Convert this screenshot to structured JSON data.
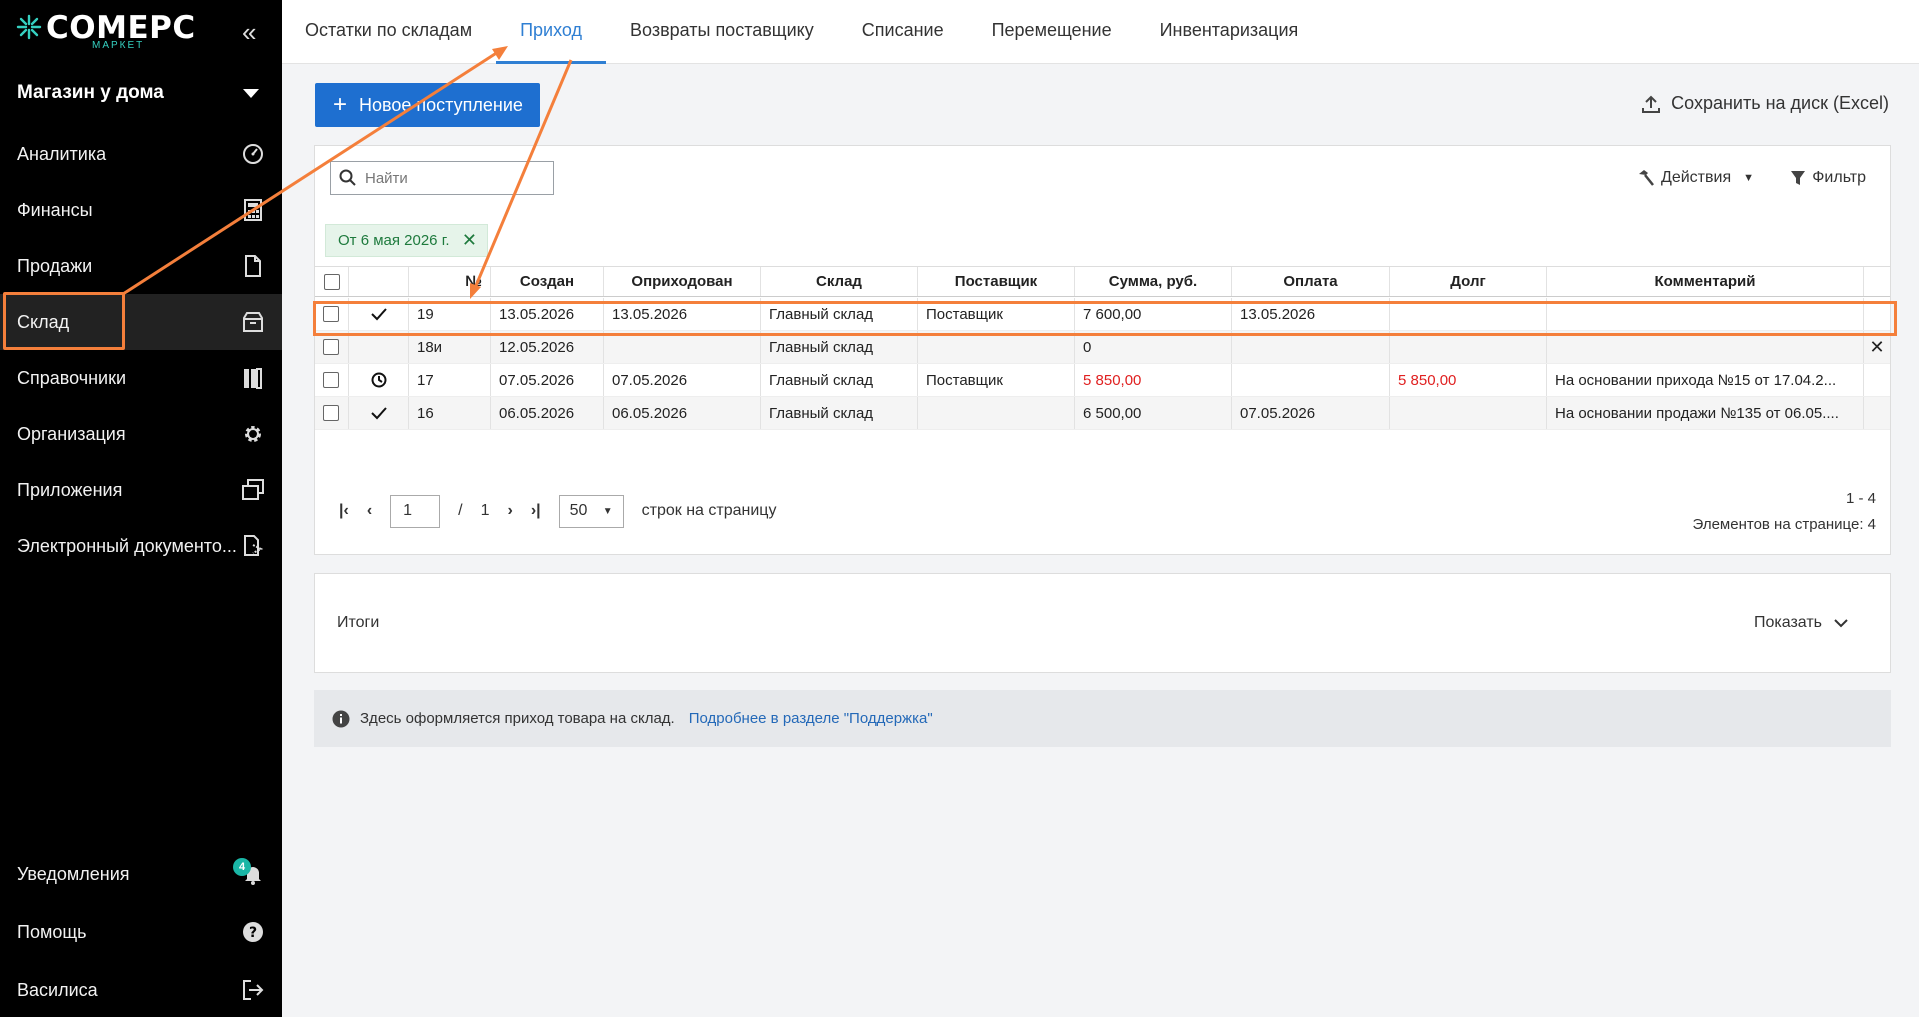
{
  "app": {
    "logo_text": "COMEPC",
    "logo_sub": "МАРКЕТ",
    "store": "Магазин у дома",
    "accent": "#1e6fd0",
    "highlight": "#f47f3b"
  },
  "sidebar": {
    "items": [
      {
        "label": "Аналитика",
        "icon": "speedometer-icon"
      },
      {
        "label": "Финансы",
        "icon": "calculator-icon"
      },
      {
        "label": "Продажи",
        "icon": "document-icon"
      },
      {
        "label": "Склад",
        "icon": "box-icon",
        "active": true
      },
      {
        "label": "Справочники",
        "icon": "books-icon"
      },
      {
        "label": "Организация",
        "icon": "gear-icon"
      },
      {
        "label": "Приложения",
        "icon": "windows-icon"
      },
      {
        "label": "Электронный документо...",
        "icon": "edoc-icon"
      }
    ],
    "bottom": [
      {
        "label": "Уведомления",
        "icon": "bell-icon",
        "badge": "4"
      },
      {
        "label": "Помощь",
        "icon": "help-icon"
      },
      {
        "label": "Василиса",
        "icon": "logout-icon"
      }
    ]
  },
  "tabs": [
    {
      "label": "Остатки по складам"
    },
    {
      "label": "Приход",
      "active": true
    },
    {
      "label": "Возвраты поставщику"
    },
    {
      "label": "Списание"
    },
    {
      "label": "Перемещение"
    },
    {
      "label": "Инвентаризация"
    }
  ],
  "toolbar": {
    "new_label": "Новое поступление",
    "export_label": "Сохранить на диск (Excel)"
  },
  "search": {
    "placeholder": "Найти"
  },
  "actions_label": "Действия",
  "filter_label": "Фильтр",
  "filter_chip": "От 6 мая 2026 г.",
  "table": {
    "columns": [
      "№",
      "Создан",
      "Оприходован",
      "Склад",
      "Поставщик",
      "Сумма, руб.",
      "Оплата",
      "Долг",
      "Комментарий"
    ],
    "rows": [
      {
        "status": "check",
        "num": "19",
        "created": "13.05.2026",
        "posted": "13.05.2026",
        "warehouse": "Главный склад",
        "supplier": "Поставщик",
        "sum": "7 600,00",
        "payment": "13.05.2026",
        "debt": "",
        "comment": "",
        "sum_red": false
      },
      {
        "status": "",
        "num": "18и",
        "created": "12.05.2026",
        "posted": "",
        "warehouse": "Главный склад",
        "supplier": "",
        "sum": "0",
        "payment": "",
        "debt": "",
        "comment": "",
        "sum_red": false,
        "closable": true
      },
      {
        "status": "clock",
        "num": "17",
        "created": "07.05.2026",
        "posted": "07.05.2026",
        "warehouse": "Главный склад",
        "supplier": "Поставщик",
        "sum": "5 850,00",
        "payment": "",
        "debt": "5 850,00",
        "comment": "На основании прихода №15 от 17.04.2...",
        "sum_red": true
      },
      {
        "status": "check",
        "num": "16",
        "created": "06.05.2026",
        "posted": "06.05.2026",
        "warehouse": "Главный склад",
        "supplier": "",
        "sum": "6 500,00",
        "payment": "07.05.2026",
        "debt": "",
        "comment": "На основании продажи №135 от 06.05....",
        "sum_red": false
      }
    ]
  },
  "pager": {
    "page": "1",
    "sep": "/",
    "total_pages": "1",
    "per_page": "50",
    "per_page_label": "строк на страницу",
    "range": "1 - 4",
    "items_label": "Элементов на странице: 4"
  },
  "totals": {
    "label": "Итоги",
    "show_label": "Показать"
  },
  "info": {
    "text": "Здесь оформляется приход товара на склад.",
    "link": "Подробнее в разделе \"Поддержка\""
  }
}
